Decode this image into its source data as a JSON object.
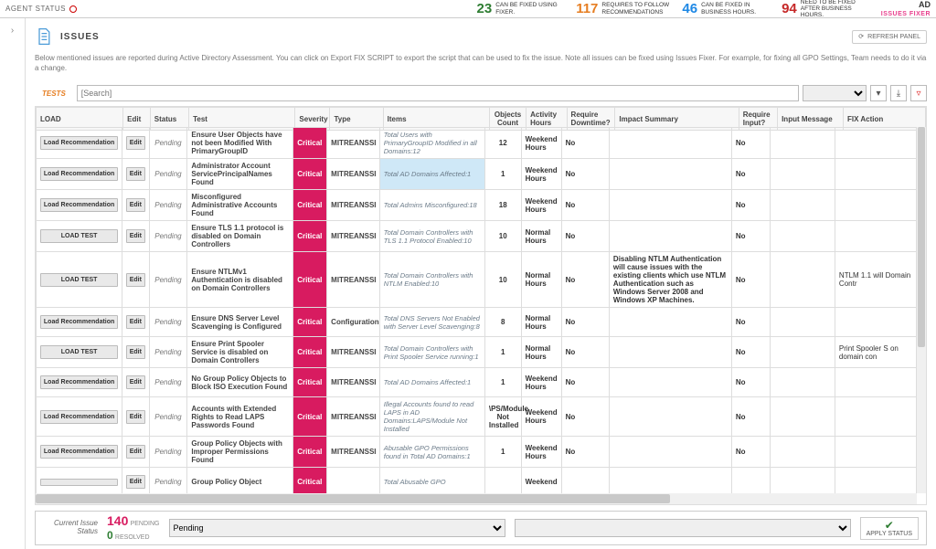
{
  "header": {
    "agent_status": "AGENT STATUS",
    "metrics": [
      {
        "value": "23",
        "label": "CAN BE FIXED USING FIXER.",
        "color": "#2e7d32"
      },
      {
        "value": "117",
        "label": "REQUIRES TO FOLLOW RECOMMENDATIONS",
        "color": "#e67e22"
      },
      {
        "value": "46",
        "label": "CAN BE FIXED IN BUSINESS HOURS.",
        "color": "#1e88e5"
      },
      {
        "value": "94",
        "label": "NEED TO BE FIXED AFTER BUSINESS HOURS.",
        "color": "#c62828"
      }
    ],
    "brand": "AD",
    "brand_sub": "ISSUES FIXER"
  },
  "panel": {
    "title": "ISSUES",
    "refresh": "REFRESH PANEL",
    "desc": "Below mentioned issues are reported during Active Directory Assessment. You can click on Export FIX SCRIPT to export the script that can be used to fix the issue. Note all issues can be fixed using Issues Fixer. For example, for fixing all GPO Settings, Team needs to do it via a change."
  },
  "search": {
    "tests_label": "TESTS",
    "placeholder": "[Search]"
  },
  "columns": [
    "LOAD",
    "Edit",
    "Status",
    "Test",
    "Severity",
    "Type",
    "Items",
    "Objects Count",
    "Activity Hours",
    "Require Downtime?",
    "Impact Summary",
    "Require Input?",
    "Input Message",
    "FIX Action"
  ],
  "rows": [
    {
      "load": "Load Recommendation",
      "test": "Ensure User Objects have not been Modified With PrimaryGroupID",
      "sev": "Critical",
      "type": "MITREANSSI",
      "items": "Total Users with PrimaryGroupID Modified in all Domains:12",
      "count": "12",
      "hours": "Weekend Hours",
      "down": "No",
      "impact": "",
      "req": "No",
      "msg": "",
      "fix": ""
    },
    {
      "load": "Load Recommendation",
      "test": "Administrator Account ServicePrincipalNames Found",
      "sev": "Critical",
      "type": "MITREANSSI",
      "items": "Total AD Domains Affected:1",
      "count": "1",
      "hours": "Weekend Hours",
      "down": "No",
      "impact": "",
      "req": "No",
      "msg": "",
      "fix": "",
      "hl": true
    },
    {
      "load": "Load Recommendation",
      "test": "Misconfigured Administrative Accounts Found",
      "sev": "Critical",
      "type": "MITREANSSI",
      "items": "Total Admins Misconfigured:18",
      "count": "18",
      "hours": "Weekend Hours",
      "down": "No",
      "impact": "",
      "req": "No",
      "msg": "",
      "fix": ""
    },
    {
      "load": "LOAD TEST",
      "test": "Ensure TLS 1.1 protocol is disabled on Domain Controllers",
      "sev": "Critical",
      "type": "MITREANSSI",
      "items": "Total Domain Controllers with TLS 1.1 Protocol Enabled:10",
      "count": "10",
      "hours": "Normal Hours",
      "down": "No",
      "impact": "",
      "req": "No",
      "msg": "",
      "fix": ""
    },
    {
      "load": "LOAD TEST",
      "test": "Ensure NTLMv1 Authentication is disabled on Domain Controllers",
      "sev": "Critical",
      "type": "MITREANSSI",
      "items": "Total Domain Controllers with NTLM Enabled:10",
      "count": "10",
      "hours": "Normal Hours",
      "down": "No",
      "impact": "Disabling NTLM Authentication will cause issues with the existing clients which use NTLM Authentication such as Windows Server 2008 and Windows XP Machines.",
      "req": "No",
      "msg": "",
      "fix": "NTLM 1.1 will Domain Contr"
    },
    {
      "load": "Load Recommendation",
      "test": "Ensure DNS Server Level Scavenging is Configured",
      "sev": "Critical",
      "type": "Configuration",
      "items": "Total DNS Servers Not Enabled with Server Level Scavenging:8",
      "count": "8",
      "hours": "Normal Hours",
      "down": "No",
      "impact": "",
      "req": "No",
      "msg": "",
      "fix": ""
    },
    {
      "load": "LOAD TEST",
      "test": "Ensure Print Spooler Service is disabled on Domain Controllers",
      "sev": "Critical",
      "type": "MITREANSSI",
      "items": "Total Domain Controllers with Print Spooler Service running:1",
      "count": "1",
      "hours": "Normal Hours",
      "down": "No",
      "impact": "",
      "req": "No",
      "msg": "",
      "fix": "Print Spooler S on domain con"
    },
    {
      "load": "Load Recommendation",
      "test": "No Group Policy Objects to Block ISO Execution Found",
      "sev": "Critical",
      "type": "MITREANSSI",
      "items": "Total AD Domains Affected:1",
      "count": "1",
      "hours": "Weekend Hours",
      "down": "No",
      "impact": "",
      "req": "No",
      "msg": "",
      "fix": ""
    },
    {
      "load": "Load Recommendation",
      "test": "Accounts with Extended Rights to Read LAPS Passwords Found",
      "sev": "Critical",
      "type": "MITREANSSI",
      "items": "Illegal Accounts found to read LAPS in AD Domains:LAPS/Module Not Installed",
      "count": "\\PS/Module Not Installed",
      "hours": "Weekend Hours",
      "down": "No",
      "impact": "",
      "req": "No",
      "msg": "",
      "fix": ""
    },
    {
      "load": "Load Recommendation",
      "test": "Group Policy Objects with Improper Permissions Found",
      "sev": "Critical",
      "type": "MITREANSSI",
      "items": "Abusable GPO Permissions found in Total AD Domains:1",
      "count": "1",
      "hours": "Weekend Hours",
      "down": "No",
      "impact": "",
      "req": "No",
      "msg": "",
      "fix": ""
    },
    {
      "load": "",
      "test": "Group Policy Object",
      "sev": "Critical",
      "type": "",
      "items": "Total Abusable GPO",
      "count": "",
      "hours": "Weekend",
      "down": "",
      "impact": "",
      "req": "",
      "msg": "",
      "fix": ""
    }
  ],
  "edit_label": "Edit",
  "pending_label": "Pending",
  "footer": {
    "title": "Current Issue Status",
    "pending_n": "140",
    "pending_l": "PENDING",
    "resolved_n": "0",
    "resolved_l": "RESOLVED",
    "sel1": "Pending",
    "apply": "APPLY STATUS"
  }
}
